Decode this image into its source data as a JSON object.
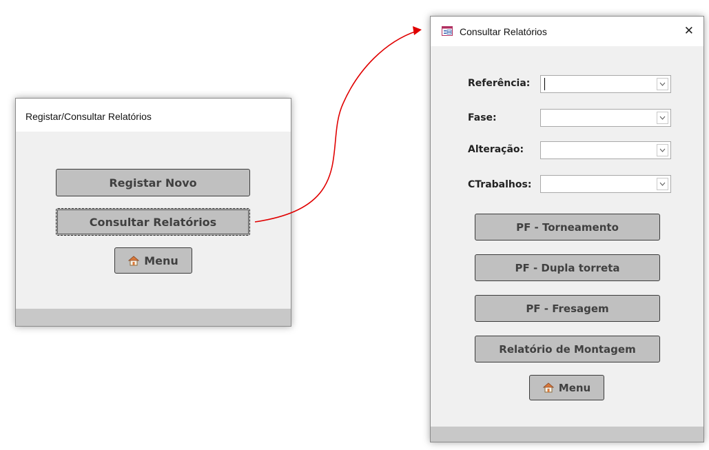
{
  "left_window": {
    "title": "Registar/Consultar Relatórios",
    "buttons": {
      "registar": "Registar Novo",
      "consultar": "Consultar Relatórios",
      "menu": "Menu"
    }
  },
  "right_window": {
    "title": "Consultar Relatórios",
    "close": "✕",
    "fields": {
      "referencia": {
        "label": "Referência:",
        "value": ""
      },
      "fase": {
        "label": "Fase:",
        "value": ""
      },
      "alteracao": {
        "label": "Alteração:",
        "value": ""
      },
      "ctrabalhos": {
        "label": "CTrabalhos:",
        "value": ""
      }
    },
    "buttons": {
      "torneamento": "PF - Torneamento",
      "dupla": "PF - Dupla torreta",
      "fresagem": "PF - Fresagem",
      "montagem": "Relatório de Montagem",
      "menu": "Menu"
    }
  },
  "colors": {
    "arrow": "#e00000",
    "button": "#c0c0c0",
    "form_bg": "#f0f0f0"
  },
  "icons": [
    "home-icon",
    "form-icon",
    "close-icon",
    "dropdown-arrow-icon"
  ]
}
